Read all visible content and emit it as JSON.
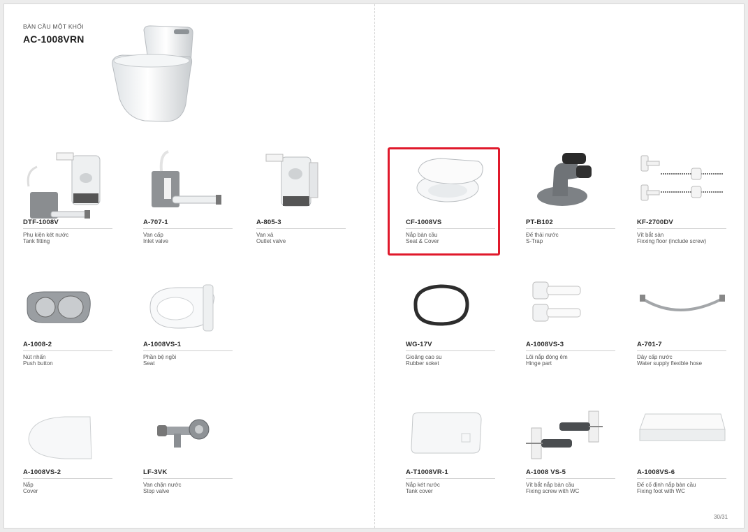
{
  "header": {
    "subtitle": "BÀN CẦU MỘT KHỐI",
    "model": "AC-1008VRN"
  },
  "parts": [
    {
      "code": "DTF-1008V",
      "vi": "Phụ kiện két nước",
      "en": "Tank fitting",
      "icon": "tank-fitting-icon"
    },
    {
      "code": "A-707-1",
      "vi": "Van cấp",
      "en": "Inlet valve",
      "icon": "inlet-valve-icon"
    },
    {
      "code": "A-805-3",
      "vi": "Van xả",
      "en": "Outlet valve",
      "icon": "outlet-valve-icon"
    },
    {
      "code": "CF-1008VS",
      "vi": "Nắp bàn cầu",
      "en": "Seat & Cover",
      "icon": "seat-cover-icon"
    },
    {
      "code": "PT-B102",
      "vi": "Đế thải nước",
      "en": "S-Trap",
      "icon": "s-trap-icon"
    },
    {
      "code": "KF-2700DV",
      "vi": "Vít bắt sàn",
      "en": "Fixxing floor (include screw)",
      "icon": "floor-screw-icon"
    },
    {
      "code": "A-1008-2",
      "vi": "Nút nhấn",
      "en": "Push button",
      "icon": "push-button-icon"
    },
    {
      "code": "A-1008VS-1",
      "vi": "Phần bệ ngồi",
      "en": "Seat",
      "icon": "seat-icon"
    },
    {
      "code": "WG-17V",
      "vi": "Gioăng cao su",
      "en": "Rubber soket",
      "icon": "rubber-gasket-icon"
    },
    {
      "code": "A-1008VS-3",
      "vi": "Lõi nắp đóng êm",
      "en": "Hinge part",
      "icon": "hinge-part-icon"
    },
    {
      "code": "A-701-7",
      "vi": "Dây cấp nước",
      "en": "Water supply flexible hose",
      "icon": "flexible-hose-icon"
    },
    {
      "code": "A-1008VS-2",
      "vi": "Nắp",
      "en": "Cover",
      "icon": "cover-icon"
    },
    {
      "code": "LF-3VK",
      "vi": "Van chặn nước",
      "en": "Stop valve",
      "icon": "stop-valve-icon"
    },
    {
      "code": "A-T1008VR-1",
      "vi": "Nắp két nước",
      "en": "Tank cover",
      "icon": "tank-cover-icon"
    },
    {
      "code": "A-1008 VS-5",
      "vi": "Vít bắt nắp bàn cầu",
      "en": "Fixing screw with WC",
      "icon": "seat-fixing-screw-icon"
    },
    {
      "code": "A-1008VS-6",
      "vi": "Đế cố định nắp bàn cầu",
      "en": "Fixing foot with WC",
      "icon": "fixing-foot-icon"
    }
  ],
  "highlighted_part": "CF-1008VS",
  "highlight_color": "#e0192b",
  "page_number": "30/31"
}
